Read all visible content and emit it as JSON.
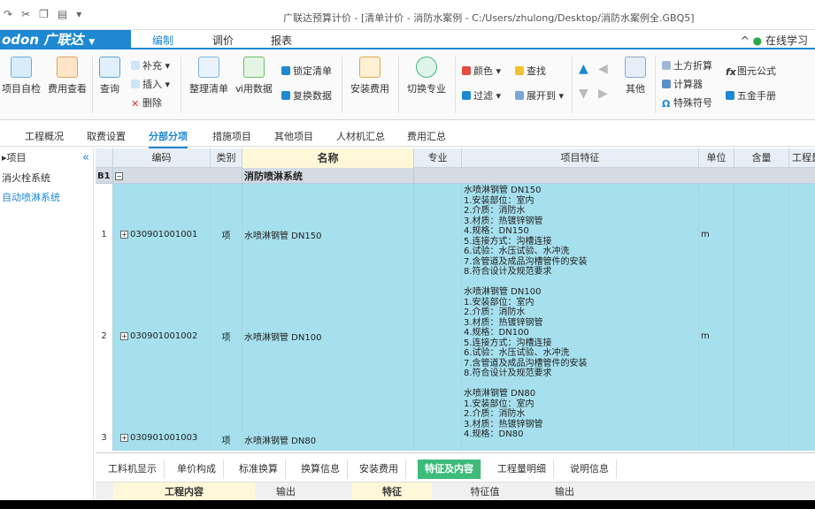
{
  "title": "广联达预算计价 - [清单计价 - 消防水案例 - C:/Users/zhulong/Desktop/消防水案例全.GBQ5]",
  "brand": {
    "logo": "odon 广联达",
    "accent": "#1e88d2"
  },
  "menu": {
    "tabs": [
      "编制",
      "调价",
      "报表"
    ],
    "active": "编制",
    "online_learn": "在线学习"
  },
  "ribbon": {
    "project_check": "项目自检",
    "fee_view": "费用查看",
    "query": "查询",
    "supplement": "补充",
    "insert": "插入",
    "delete": "删除",
    "organize_list": "整理清单",
    "use_data": "ⅵ用数据",
    "lock_list": "锁定清单",
    "lock_data": "复换数据",
    "install_fee": "安装费用",
    "switch_major": "切换专业",
    "color": "颜色",
    "filter": "过滤",
    "find": "查找",
    "expand_to": "展开到",
    "others": "其他",
    "earthwork": "土方折算",
    "calculator": "计算器",
    "special_symbol": "特殊符号",
    "figure_formula": "图元公式",
    "five_gold": "五金手册"
  },
  "subtabs": {
    "items": [
      "工程概况",
      "取费设置",
      "分部分项",
      "措施项目",
      "其他项目",
      "人材机汇总",
      "费用汇总"
    ],
    "active": "分部分项"
  },
  "left_panel": {
    "header": "▸项目",
    "items": [
      "消火栓系统",
      "自动喷淋系统"
    ]
  },
  "grid": {
    "columns": [
      "编码",
      "类别",
      "名称",
      "专业",
      "项目特征",
      "单位",
      "含量",
      "工程量"
    ],
    "group": {
      "id": "B1",
      "name": "消防喷淋系统"
    },
    "rows": [
      {
        "num": "1",
        "code": "030901001001",
        "type": "项",
        "name": "水喷淋钢管 DN150",
        "unit": "m",
        "features": [
          "水喷淋钢管 DN150",
          "1.安装部位：室内",
          "2.介质：消防水",
          "3.材质：热镀锌钢管",
          "4.规格：DN150",
          "5.连接方式：沟槽连接",
          "6.试验：水压试验、水冲洗",
          "7.含管道及成品沟槽管件的安装",
          "8.符合设计及规范要求"
        ]
      },
      {
        "num": "2",
        "code": "030901001002",
        "type": "项",
        "name": "水喷淋钢管 DN100",
        "unit": "m",
        "features": [
          "水喷淋钢管 DN100",
          "1.安装部位：室内",
          "2.介质：消防水",
          "3.材质：热镀锌钢管",
          "4.规格：DN100",
          "5.连接方式：沟槽连接",
          "6.试验：水压试验、水冲洗",
          "7.含管道及成品沟槽管件的安装",
          "8.符合设计及规范要求"
        ]
      },
      {
        "num": "3",
        "code": "030901001003",
        "type": "项",
        "name": "水喷淋钢管 DN80",
        "unit": "",
        "features": [
          "水喷淋钢管 DN80",
          "1.安装部位：室内",
          "2.介质：消防水",
          "3.材质：热镀锌钢管",
          "4.规格：DN80"
        ]
      }
    ]
  },
  "bottom": {
    "tabs": [
      "工料机显示",
      "单价构成",
      "标准换算",
      "换算信息",
      "安装费用",
      "特征及内容",
      "工程量明细",
      "说明信息"
    ],
    "active": "特征及内容",
    "headers": [
      "工程内容",
      "输出",
      "特征",
      "特征值",
      "输出"
    ]
  }
}
